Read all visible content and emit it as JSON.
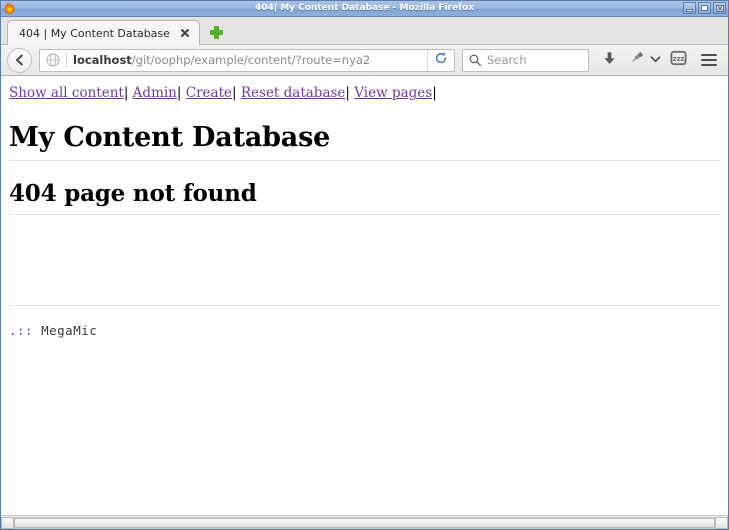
{
  "window": {
    "title": "404| My Content Database - Mozilla Firefox",
    "logo_icon": "firefox-logo-icon",
    "controls": {
      "minimize": "minimize-button",
      "maximize": "maximize-button",
      "close": "close-button"
    }
  },
  "tabs": [
    {
      "label": "404 | My Content Database",
      "close_icon": "close-icon",
      "active": true
    }
  ],
  "newtab": {
    "label": "+",
    "icon": "plus-icon"
  },
  "toolbar": {
    "back_icon": "back-arrow-icon",
    "url": {
      "host": "localhost",
      "path": "/git/oophp/example/content/?route=nya2",
      "full": "localhost/git/oophp/example/content/?route=nya2",
      "identity_icon": "globe-icon"
    },
    "reload_icon": "reload-icon",
    "search": {
      "placeholder": "Search",
      "icon": "search-icon"
    },
    "downloads_icon": "download-arrow-icon",
    "addon_icon": "pin-icon",
    "addon_chevron_icon": "chevron-down-icon",
    "pocket_icon": "zzz-pocket-icon",
    "menu_icon": "hamburger-menu-icon"
  },
  "page": {
    "nav_links": [
      "Show all content",
      "Admin",
      "Create",
      "Reset database",
      "View pages"
    ],
    "nav_separator": "|",
    "title": "My Content Database",
    "subtitle": "404 page not found",
    "footer": {
      "dots": ".::",
      "brand": "MegaMic"
    }
  },
  "scrollbar": {
    "left_arrow": "scroll-left-arrow",
    "right_arrow": "scroll-right-arrow"
  },
  "colors": {
    "titlebar_blue": "#9bb7e0",
    "link_purple": "#6f3a9e",
    "newtab_green": "#56ac2a",
    "rule_gray": "#e3e3e3"
  }
}
